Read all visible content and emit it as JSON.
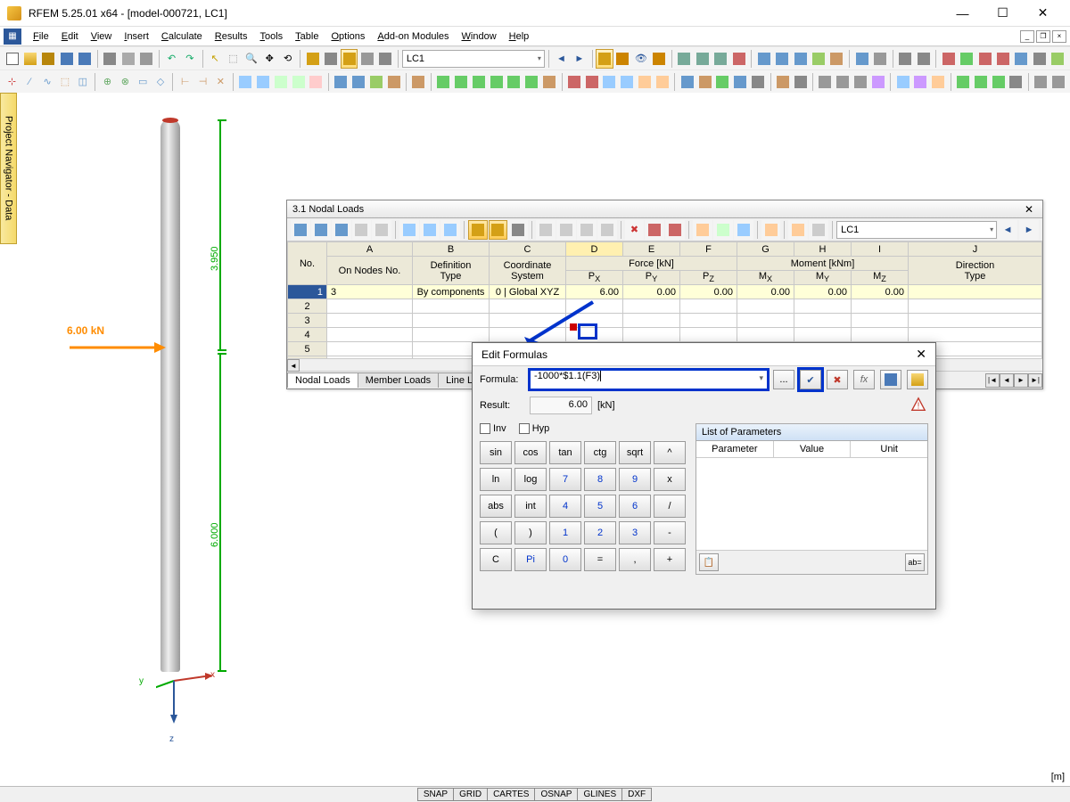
{
  "app": {
    "title": "RFEM 5.25.01 x64 - [model-000721, LC1]"
  },
  "menu": {
    "items": [
      "File",
      "Edit",
      "View",
      "Insert",
      "Calculate",
      "Results",
      "Tools",
      "Table",
      "Options",
      "Add-on Modules",
      "Window",
      "Help"
    ]
  },
  "toolbar": {
    "lc_combo": "LC1"
  },
  "navigator": {
    "tab": "Project Navigator - Data"
  },
  "viewport": {
    "load_label": "6.00 kN",
    "dim_upper": "3.950",
    "dim_lower": "6.000",
    "axis_x": "x",
    "axis_y": "y",
    "axis_z": "z",
    "unit": "[m]"
  },
  "panel": {
    "title": "3.1 Nodal Loads",
    "lc_combo": "LC1",
    "columns_letters": [
      "A",
      "B",
      "C",
      "D",
      "E",
      "F",
      "G",
      "H",
      "I",
      "J"
    ],
    "group_headers": {
      "no": "No.",
      "on_nodes": "On Nodes No.",
      "def_type": "Definition\nType",
      "coord": "Coordinate\nSystem",
      "force": "Force [kN]",
      "moment": "Moment [kNm]",
      "dir": "Direction\nType",
      "px": "PX",
      "py": "PY",
      "pz": "PZ",
      "mx": "MX",
      "my": "MY",
      "mz": "MZ"
    },
    "rows": [
      {
        "no": "1",
        "nodes": "3",
        "def": "By components",
        "coord": "0 | Global XYZ",
        "px": "6.00",
        "py": "0.00",
        "pz": "0.00",
        "mx": "0.00",
        "my": "0.00",
        "mz": "0.00",
        "dir": ""
      }
    ],
    "tabs": [
      "Nodal Loads",
      "Member Loads",
      "Line Loads"
    ]
  },
  "dialog": {
    "title": "Edit Formulas",
    "formula_label": "Formula:",
    "formula_value": "-1000*$1.1(F3)",
    "result_label": "Result:",
    "result_value": "6.00",
    "result_unit": "[kN]",
    "inv": "Inv",
    "hyp": "Hyp",
    "calc": [
      [
        "sin",
        "cos",
        "tan",
        "ctg",
        "sqrt",
        "^"
      ],
      [
        "ln",
        "log",
        "7",
        "8",
        "9",
        "x"
      ],
      [
        "abs",
        "int",
        "4",
        "5",
        "6",
        "/"
      ],
      [
        "(",
        ")",
        "1",
        "2",
        "3",
        "-"
      ],
      [
        "C",
        "Pi",
        "0",
        "=",
        ",",
        "+"
      ]
    ],
    "params_title": "List of Parameters",
    "params_cols": [
      "Parameter",
      "Value",
      "Unit"
    ],
    "ellipsis": "..."
  },
  "status": {
    "buttons": [
      "SNAP",
      "GRID",
      "CARTES",
      "OSNAP",
      "GLINES",
      "DXF"
    ]
  }
}
